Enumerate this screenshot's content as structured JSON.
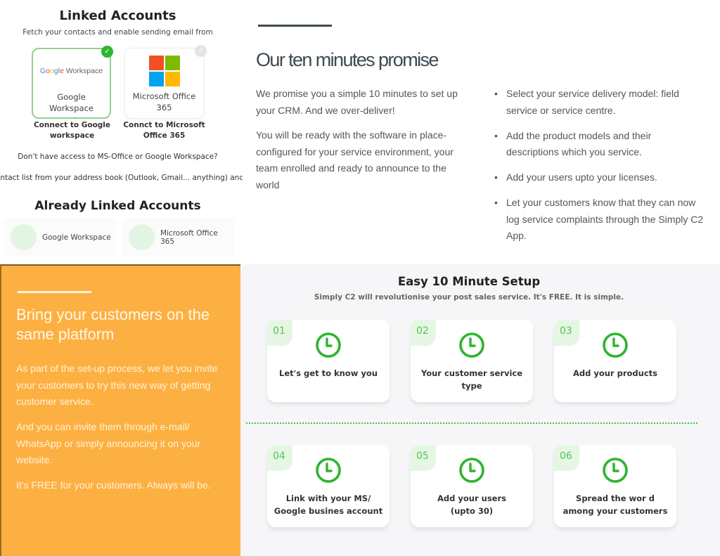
{
  "linked_accounts": {
    "title": "Linked Accounts",
    "subtitle": "Fetch your contacts and enable sending email from",
    "cards": [
      {
        "logo_text_parts": [
          "G",
          "o",
          "o",
          "g",
          "l",
          "e"
        ],
        "logo_suffix": " Workspace",
        "name_line1": "Google",
        "name_line2": "Workspace",
        "cta_line1": "Connect to Google",
        "cta_line2": "workspace",
        "selected": true,
        "check_icon": "✓"
      },
      {
        "logo": "microsoft-logo",
        "logo_colors": [
          "#f25022",
          "#7fba00",
          "#00a4ef",
          "#ffb900"
        ],
        "name_line1": "Microsoft Office",
        "name_line2": "365",
        "cta_line1": "Connct to Microsoft",
        "cta_line2": "Office 365",
        "selected": false,
        "check_icon": "✓"
      }
    ],
    "no_access_text": "Don't have access to MS-Office or Google Workspace?",
    "upload_text": "ontact list from your address book (Outlook, Gmail... anything) and uplc",
    "already_linked_title": "Already Linked Accounts",
    "already_linked": [
      "Google Workspace",
      "Microsoft Office 365"
    ]
  },
  "promise": {
    "title": "Our ten minutes promise",
    "paragraphs": [
      "We promise you a simple 10 minutes to set up your CRM. And we over-deliver!",
      "You will be ready with the software in place- configured for your service environment, your team enrolled and ready to announce to the world"
    ],
    "bullets": [
      "Select your service delivery model: field service or service centre.",
      "Add the product models and their descriptions which you service.",
      "Add your users upto your licenses.",
      "Let your customers know that they can now log service complaints through the Simply C2 App."
    ]
  },
  "customers": {
    "title": "Bring your customers on the same platform",
    "paragraphs": [
      "As part of the set-up process, we let you invite your customers to try this new way of getting customer service.",
      "And you can invite them through e-mail/ WhatsApp or simply announcing it on your website.",
      "It's FREE for your customers. Always will be."
    ],
    "accent_color": "#fdb042"
  },
  "setup": {
    "title": "Easy 10 Minute Setup",
    "subtitle": "Simply C2 will revolutionise your post sales service. It's FREE. It is simple.",
    "accent_color": "#2db52d",
    "steps": [
      {
        "num": "01",
        "icon": "clock-icon",
        "line1": "Let's get to know you",
        "line2": ""
      },
      {
        "num": "02",
        "icon": "clock-icon",
        "line1": "Your customer service",
        "line2": "type"
      },
      {
        "num": "03",
        "icon": "clock-icon",
        "line1": "Add your products",
        "line2": ""
      },
      {
        "num": "04",
        "icon": "clock-icon",
        "line1": "Link with your MS/",
        "line2": "Google busines account"
      },
      {
        "num": "05",
        "icon": "clock-icon",
        "line1": "Add your users",
        "line2": "(upto 30)"
      },
      {
        "num": "06",
        "icon": "clock-icon",
        "line1": "Spread the wor d",
        "line2": "among your customers"
      }
    ]
  }
}
